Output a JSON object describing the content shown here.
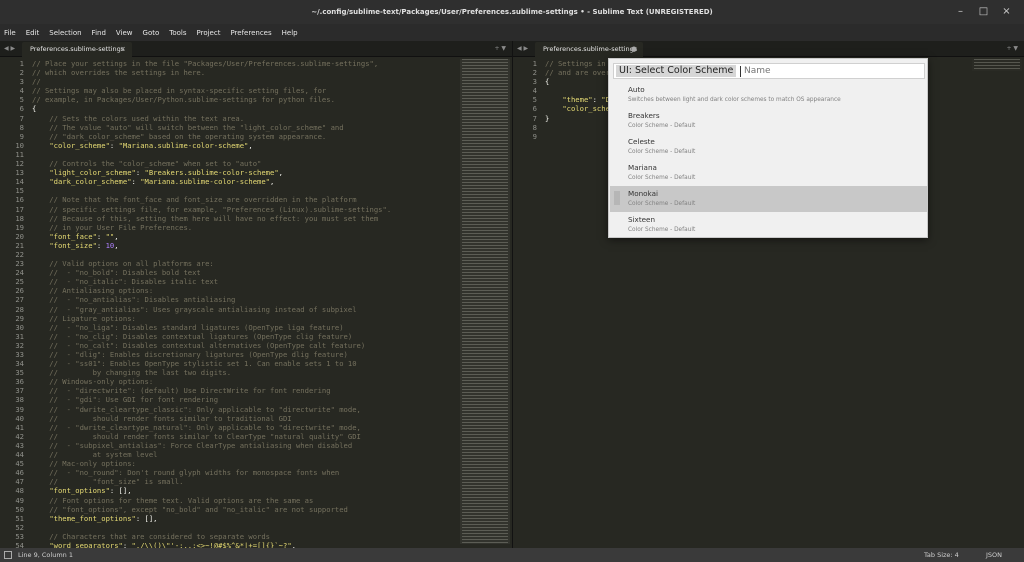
{
  "window": {
    "title": "~/.config/sublime-text/Packages/User/Preferences.sublime-settings • - Sublime Text (UNREGISTERED)"
  },
  "menu": [
    "File",
    "Edit",
    "Selection",
    "Find",
    "View",
    "Goto",
    "Tools",
    "Project",
    "Preferences",
    "Help"
  ],
  "left_tab": {
    "label": "Preferences.sublime-settings",
    "close": "×"
  },
  "right_tab": {
    "label": "Preferences.sublime-settings",
    "close": "●"
  },
  "palette": {
    "prompt": "UI: Select Color Scheme",
    "placeholder": "Name",
    "items": [
      {
        "title": "Auto",
        "desc": "Switches between light and dark color schemes to match OS appearance"
      },
      {
        "title": "Breakers",
        "desc": "Color Scheme - Default"
      },
      {
        "title": "Celeste",
        "desc": "Color Scheme - Default"
      },
      {
        "title": "Mariana",
        "desc": "Color Scheme - Default"
      },
      {
        "title": "Monokai",
        "desc": "Color Scheme - Default",
        "selected": true
      },
      {
        "title": "Sixteen",
        "desc": "Color Scheme - Default"
      }
    ]
  },
  "left_editor": {
    "start_line": 1,
    "lines": [
      [
        [
          "c",
          "// Place your settings in the file \"Packages/User/Preferences.sublime-settings\","
        ]
      ],
      [
        [
          "c",
          "// which overrides the settings in here."
        ]
      ],
      [
        [
          "c",
          "//"
        ]
      ],
      [
        [
          "c",
          "// Settings may also be placed in syntax-specific setting files, for"
        ]
      ],
      [
        [
          "c",
          "// example, in Packages/User/Python.sublime-settings for python files."
        ]
      ],
      [
        [
          "t",
          "{"
        ]
      ],
      [
        [
          "c",
          "    // Sets the colors used within the text area."
        ]
      ],
      [
        [
          "c",
          "    // The value \"auto\" will switch between the \"light_color_scheme\" and"
        ]
      ],
      [
        [
          "c",
          "    // \"dark_color_scheme\" based on the operating system appearance."
        ]
      ],
      [
        [
          "t",
          "    "
        ],
        [
          "s",
          "\"color_scheme\""
        ],
        [
          "t",
          ": "
        ],
        [
          "s",
          "\"Mariana.sublime-color-scheme\""
        ],
        [
          "t",
          ","
        ]
      ],
      [
        [
          "t",
          ""
        ]
      ],
      [
        [
          "c",
          "    // Controls the \"color_scheme\" when set to \"auto\""
        ]
      ],
      [
        [
          "t",
          "    "
        ],
        [
          "s",
          "\"light_color_scheme\""
        ],
        [
          "t",
          ": "
        ],
        [
          "s",
          "\"Breakers.sublime-color-scheme\""
        ],
        [
          "t",
          ","
        ]
      ],
      [
        [
          "t",
          "    "
        ],
        [
          "s",
          "\"dark_color_scheme\""
        ],
        [
          "t",
          ": "
        ],
        [
          "s",
          "\"Mariana.sublime-color-scheme\""
        ],
        [
          "t",
          ","
        ]
      ],
      [
        [
          "t",
          ""
        ]
      ],
      [
        [
          "c",
          "    // Note that the font_face and font_size are overridden in the platform"
        ]
      ],
      [
        [
          "c",
          "    // specific settings file, for example, \"Preferences (Linux).sublime-settings\"."
        ]
      ],
      [
        [
          "c",
          "    // Because of this, setting them here will have no effect: you must set them"
        ]
      ],
      [
        [
          "c",
          "    // in your User File Preferences."
        ]
      ],
      [
        [
          "t",
          "    "
        ],
        [
          "s",
          "\"font_face\""
        ],
        [
          "t",
          ": "
        ],
        [
          "s",
          "\"\""
        ],
        [
          "t",
          ","
        ]
      ],
      [
        [
          "t",
          "    "
        ],
        [
          "s",
          "\"font_size\""
        ],
        [
          "t",
          ": "
        ],
        [
          "n",
          "10"
        ],
        [
          "t",
          ","
        ]
      ],
      [
        [
          "t",
          ""
        ]
      ],
      [
        [
          "c",
          "    // Valid options on all platforms are:"
        ]
      ],
      [
        [
          "c",
          "    //  - \"no_bold\": Disables bold text"
        ]
      ],
      [
        [
          "c",
          "    //  - \"no_italic\": Disables italic text"
        ]
      ],
      [
        [
          "c",
          "    // Antialiasing options:"
        ]
      ],
      [
        [
          "c",
          "    //  - \"no_antialias\": Disables antialiasing"
        ]
      ],
      [
        [
          "c",
          "    //  - \"gray_antialias\": Uses grayscale antialiasing instead of subpixel"
        ]
      ],
      [
        [
          "c",
          "    // Ligature options:"
        ]
      ],
      [
        [
          "c",
          "    //  - \"no_liga\": Disables standard ligatures (OpenType liga feature)"
        ]
      ],
      [
        [
          "c",
          "    //  - \"no_clig\": Disables contextual ligatures (OpenType clig feature)"
        ]
      ],
      [
        [
          "c",
          "    //  - \"no_calt\": Disables contextual alternatives (OpenType calt feature)"
        ]
      ],
      [
        [
          "c",
          "    //  - \"dlig\": Enables discretionary ligatures (OpenType dlig feature)"
        ]
      ],
      [
        [
          "c",
          "    //  - \"ss01\": Enables OpenType stylistic set 1. Can enable sets 1 to 10"
        ]
      ],
      [
        [
          "c",
          "    //        by changing the last two digits."
        ]
      ],
      [
        [
          "c",
          "    // Windows-only options:"
        ]
      ],
      [
        [
          "c",
          "    //  - \"directwrite\": (default) Use DirectWrite for font rendering"
        ]
      ],
      [
        [
          "c",
          "    //  - \"gdi\": Use GDI for font rendering"
        ]
      ],
      [
        [
          "c",
          "    //  - \"dwrite_cleartype_classic\": Only applicable to \"directwrite\" mode,"
        ]
      ],
      [
        [
          "c",
          "    //        should render fonts similar to traditional GDI"
        ]
      ],
      [
        [
          "c",
          "    //  - \"dwrite_cleartype_natural\": Only applicable to \"directwrite\" mode,"
        ]
      ],
      [
        [
          "c",
          "    //        should render fonts similar to ClearType \"natural quality\" GDI"
        ]
      ],
      [
        [
          "c",
          "    //  - \"subpixel_antialias\": Force ClearType antialiasing when disabled"
        ]
      ],
      [
        [
          "c",
          "    //        at system level"
        ]
      ],
      [
        [
          "c",
          "    // Mac-only options:"
        ]
      ],
      [
        [
          "c",
          "    //  - \"no_round\": Don't round glyph widths for monospace fonts when"
        ]
      ],
      [
        [
          "c",
          "    //        \"font_size\" is small."
        ]
      ],
      [
        [
          "t",
          "    "
        ],
        [
          "s",
          "\"font_options\""
        ],
        [
          "t",
          ": [],"
        ]
      ],
      [
        [
          "c",
          "    // Font options for theme text. Valid options are the same as"
        ]
      ],
      [
        [
          "c",
          "    // \"font_options\", except \"no_bold\" and \"no_italic\" are not supported"
        ]
      ],
      [
        [
          "t",
          "    "
        ],
        [
          "s",
          "\"theme_font_options\""
        ],
        [
          "t",
          ": [],"
        ]
      ],
      [
        [
          "t",
          ""
        ]
      ],
      [
        [
          "c",
          "    // Characters that are considered to separate words"
        ]
      ],
      [
        [
          "t",
          "    "
        ],
        [
          "s",
          "\"word_separators\""
        ],
        [
          "t",
          ": "
        ],
        [
          "s",
          "\"./\\\\()\\\"'-:,.;<>~!@#$%^&*|+=[]{}`~?\""
        ],
        [
          "t",
          ","
        ]
      ]
    ]
  },
  "right_editor": {
    "start_line": 1,
    "lines": [
      [
        [
          "c",
          "// Settings in"
        ]
      ],
      [
        [
          "c",
          "// and are over"
        ]
      ],
      [
        [
          "t",
          "{"
        ]
      ],
      [
        [
          "t",
          ""
        ]
      ],
      [
        [
          "t",
          "    "
        ],
        [
          "s",
          "\"theme\""
        ],
        [
          "t",
          ": "
        ],
        [
          "s",
          "\"D"
        ]
      ],
      [
        [
          "t",
          "    "
        ],
        [
          "s",
          "\"color_sche"
        ]
      ],
      [
        [
          "t",
          "}"
        ]
      ],
      [
        [
          "t",
          ""
        ]
      ],
      [
        [
          "t",
          ""
        ]
      ]
    ]
  },
  "status": {
    "position": "Line 9, Column 1",
    "tab_size": "Tab Size: 4",
    "syntax": "JSON"
  }
}
